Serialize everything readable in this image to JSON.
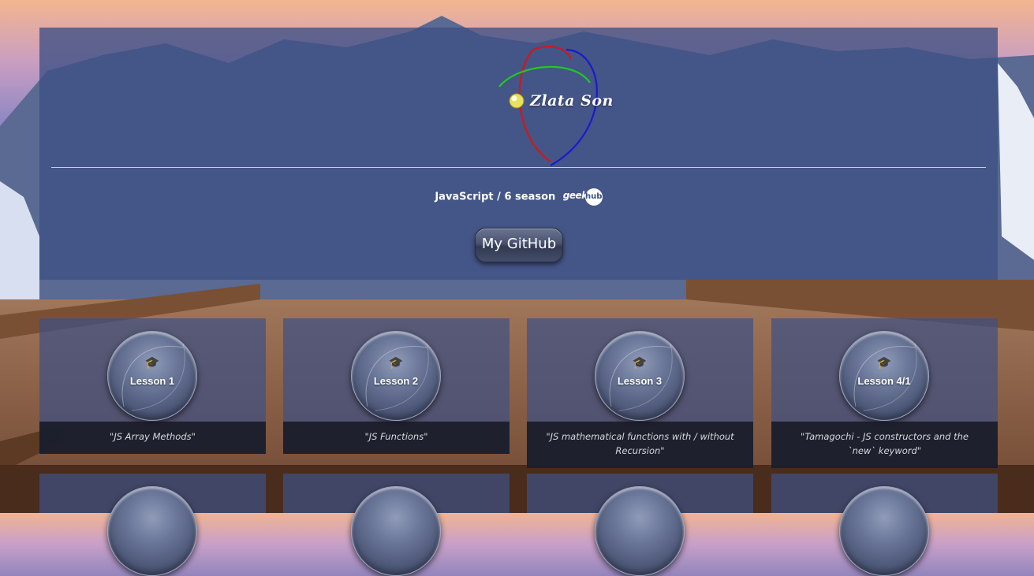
{
  "header": {
    "logo_text": "Zlata Son",
    "subtitle": "JavaScript / 6 season",
    "geekhub_text": "geek",
    "geekhub_circle": "hub",
    "github_button": "My GitHub"
  },
  "lessons": [
    {
      "label": "Lesson 1",
      "description": "\"JS Array Methods\""
    },
    {
      "label": "Lesson 2",
      "description": "\"JS Functions\""
    },
    {
      "label": "Lesson 3",
      "description": "\"JS mathematical functions with / without Recursion\""
    },
    {
      "label": "Lesson 4/1",
      "description": "\"Tamagochi - JS constructors and the `new` keyword\""
    }
  ],
  "icons": {
    "lesson_icon": "graduation-cap-icon",
    "logo_icon": "sphere-logo-icon"
  },
  "colors": {
    "panel": "#3e5084",
    "description_bg": "#14161e",
    "logo_red": "#d01818",
    "logo_green": "#22c822",
    "logo_blue": "#1a1ad0"
  }
}
